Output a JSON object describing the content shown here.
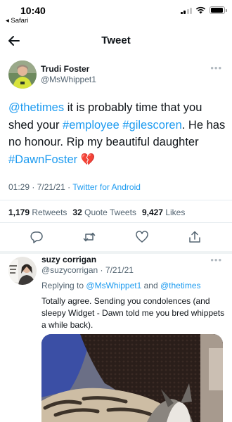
{
  "status_bar": {
    "time": "10:40",
    "back_app": "◂ Safari"
  },
  "header": {
    "title": "Tweet"
  },
  "tweet": {
    "author_name": "Trudi Foster",
    "author_handle": "@MsWhippet1",
    "text_parts": {
      "mention": "@thetimes",
      "text1": " it is probably time that you shed your ",
      "tag1": "#employee",
      "space": " ",
      "tag2": "#gilescoren",
      "text2": ". He has no honour. Rip my beautiful daughter ",
      "tag3": "#DawnFoster",
      "emoji": " 💔"
    },
    "time": "01:29",
    "date": "7/21/21",
    "separator": " · ",
    "source": "Twitter for Android",
    "retweets_count": "1,179",
    "retweets_label": "Retweets",
    "quotes_count": "32",
    "quotes_label": "Quote Tweets",
    "likes_count": "9,427",
    "likes_label": "Likes"
  },
  "reply": {
    "author_name": "suzy corrigan",
    "author_handle": "@suzycorrigan",
    "date": "7/21/21",
    "replying_label": "Replying to",
    "replying_to_1": "@MsWhippet1",
    "replying_and": "and",
    "replying_to_2": "@thetimes",
    "text": "Totally agree. Sending you condolences (and sleepy Widget - Dawn told me you bred whippets a while back)."
  },
  "colors": {
    "link": "#1d9bf0",
    "secondary": "#536471",
    "text": "#0f1419",
    "heart": "#c9302c"
  }
}
